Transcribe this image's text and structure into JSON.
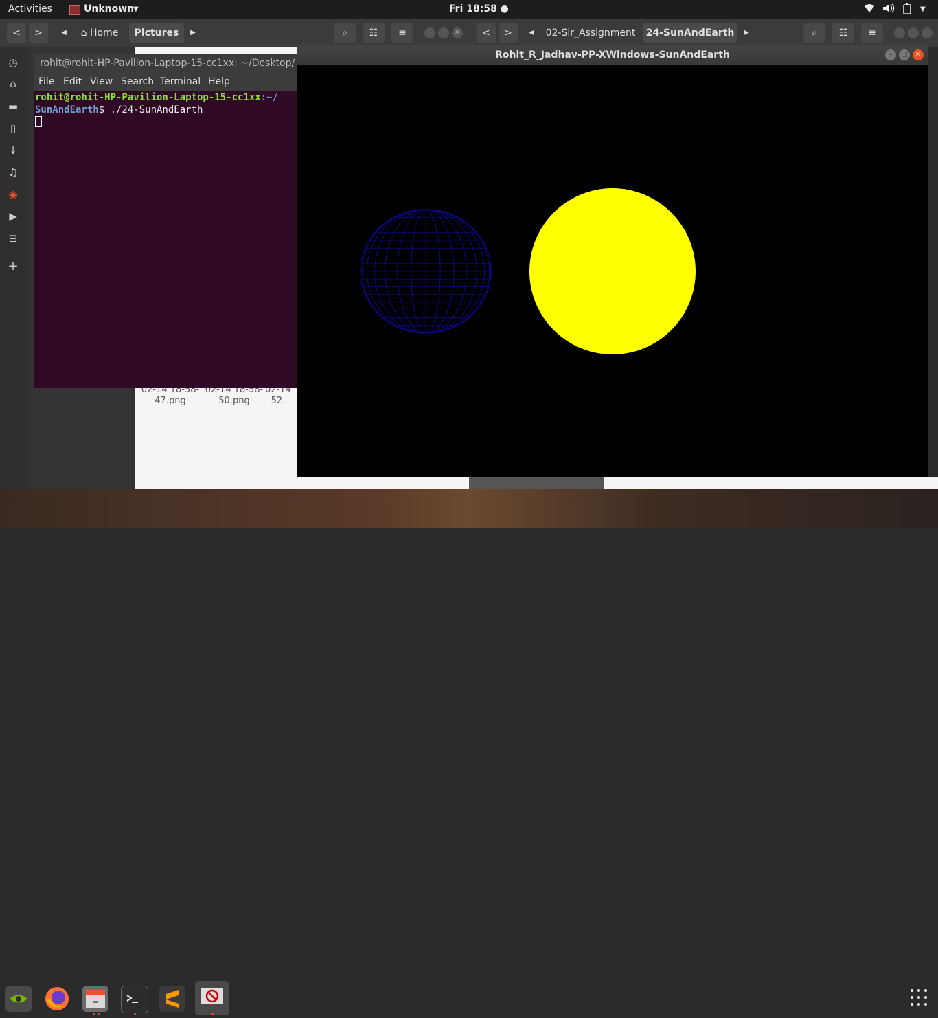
{
  "topbar": {
    "activities": "Activities",
    "app_name": "Unknown",
    "clock": "Fri 18:58 ●"
  },
  "files_window_1": {
    "nav_back": "<",
    "nav_fwd": ">",
    "path": [
      "Home",
      "Pictures"
    ],
    "file_labels": [
      {
        "line1": "02-14 18-58-",
        "line2": "47.png"
      },
      {
        "line1": "02-14 18-58-",
        "line2": "50.png"
      },
      {
        "line1": "02-14",
        "line2": "52."
      }
    ]
  },
  "files_window_2": {
    "path": [
      "02-Sir_Assignment",
      "24-SunAndEarth"
    ]
  },
  "terminal": {
    "title": "rohit@rohit-HP-Pavilion-Laptop-15-cc1xx: ~/Desktop/",
    "menu": [
      "File",
      "Edit",
      "View",
      "Search",
      "Terminal",
      "Help"
    ],
    "prompt_user": "rohit@rohit-HP-Pavilion-Laptop-15-cc1xx",
    "prompt_path_1": ":~/",
    "prompt_path_2": "SunAndEarth",
    "command": "$ ./24-SunAndEarth"
  },
  "gl_window": {
    "title": "Rohit_R_Jadhav-PP-XWindows-SunAndEarth",
    "sun_color": "#ffff00",
    "earth_color": "#0a0a8c",
    "background": "#000000"
  },
  "dock": {
    "icons": [
      "nvidia-icon",
      "firefox-icon",
      "files-icon",
      "terminal-icon",
      "sublime-icon",
      "opengl-app-icon"
    ],
    "grid_label": "Show Applications"
  }
}
